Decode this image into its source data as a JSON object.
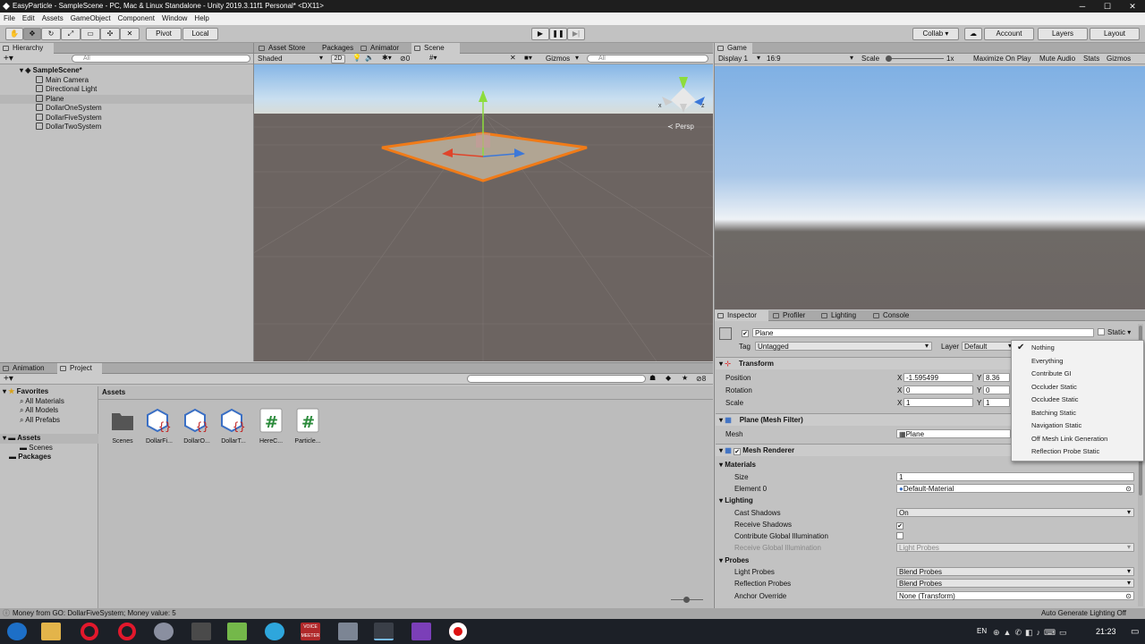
{
  "window": {
    "title": "EasyParticle - SampleScene - PC, Mac & Linux Standalone - Unity 2019.3.11f1 Personal* <DX11>",
    "minimize": "─",
    "maximize": "☐",
    "close": "✕"
  },
  "menu": [
    "File",
    "Edit",
    "Assets",
    "GameObject",
    "Component",
    "Window",
    "Help"
  ],
  "toolbar": {
    "pivot": "Pivot",
    "local": "Local",
    "collab": "Collab ▾",
    "account": "Account",
    "layers": "Layers",
    "layout": "Layout"
  },
  "hierarchy": {
    "tab": "Hierarchy",
    "search_placeholder": "All",
    "scene": "SampleScene*",
    "objects": [
      "Main Camera",
      "Directional Light",
      "Plane",
      "DollarOneSystem",
      "DollarFiveSystem",
      "DollarTwoSystem"
    ],
    "selected": "Plane"
  },
  "scene_tabs": [
    "Asset Store",
    "Packages",
    "Animator",
    "Scene"
  ],
  "scene_bar": {
    "shading": "Shaded",
    "mode2d": "2D",
    "hidden_count": "0",
    "gizmos": "Gizmos",
    "search_placeholder": "All",
    "persp": "Persp",
    "axis_x": "x",
    "axis_z": "z"
  },
  "game": {
    "tab": "Game",
    "display": "Display 1",
    "aspect": "16:9",
    "scale_label": "Scale",
    "scale_value": "1x",
    "maximize": "Maximize On Play",
    "mute": "Mute Audio",
    "stats": "Stats",
    "gizmos": "Gizmos"
  },
  "bottom_tabs": [
    "Animation",
    "Project"
  ],
  "project": {
    "hidden_count": "8",
    "favorites_label": "Favorites",
    "favorites": [
      "All Materials",
      "All Models",
      "All Prefabs"
    ],
    "assets_label": "Assets",
    "assets_children": [
      "Scenes"
    ],
    "packages_label": "Packages",
    "breadcrumb": "Assets",
    "items": [
      "Scenes",
      "DollarFi...",
      "DollarO...",
      "DollarT...",
      "HereC...",
      "Particle..."
    ]
  },
  "inspector": {
    "tabs": [
      "Inspector",
      "Profiler",
      "Lighting",
      "Console"
    ],
    "object_name": "Plane",
    "static_label": "Static",
    "tag_label": "Tag",
    "tag": "Untagged",
    "layer_label": "Layer",
    "layer": "Default",
    "transform": {
      "title": "Transform",
      "position_label": "Position",
      "rotation_label": "Rotation",
      "scale_label": "Scale",
      "px": "-1.595499",
      "py": "8.36",
      "rx": "0",
      "ry": "0",
      "sx": "1",
      "sy": "1",
      "xl": "X",
      "yl": "Y"
    },
    "mesh_filter": {
      "title": "Plane (Mesh Filter)",
      "mesh_label": "Mesh",
      "mesh": "Plane"
    },
    "mesh_renderer": {
      "title": "Mesh Renderer",
      "materials": "Materials",
      "size_label": "Size",
      "size": "1",
      "element0_label": "Element 0",
      "element0": "Default-Material",
      "lighting": "Lighting",
      "cast_label": "Cast Shadows",
      "cast": "On",
      "receive_label": "Receive Shadows",
      "cgi_label": "Contribute Global Illumination",
      "rgi_label": "Receive Global Illumination",
      "rgi": "Light Probes",
      "probes": "Probes",
      "lp_label": "Light Probes",
      "lp": "Blend Probes",
      "rp_label": "Reflection Probes",
      "rp": "Blend Probes",
      "anchor_label": "Anchor Override",
      "anchor": "None (Transform)"
    }
  },
  "static_menu": [
    "Nothing",
    "Everything",
    "Contribute GI",
    "Occluder Static",
    "Occludee Static",
    "Batching Static",
    "Navigation Static",
    "Off Mesh Link Generation",
    "Reflection Probe Static"
  ],
  "status": {
    "message": "Money from GO: DollarFiveSystem; Money value: 5",
    "right": "Auto Generate Lighting Off"
  },
  "taskbar": {
    "lang": "EN",
    "time": "21:23",
    "voicemeeter": "VOICE MEETER"
  }
}
